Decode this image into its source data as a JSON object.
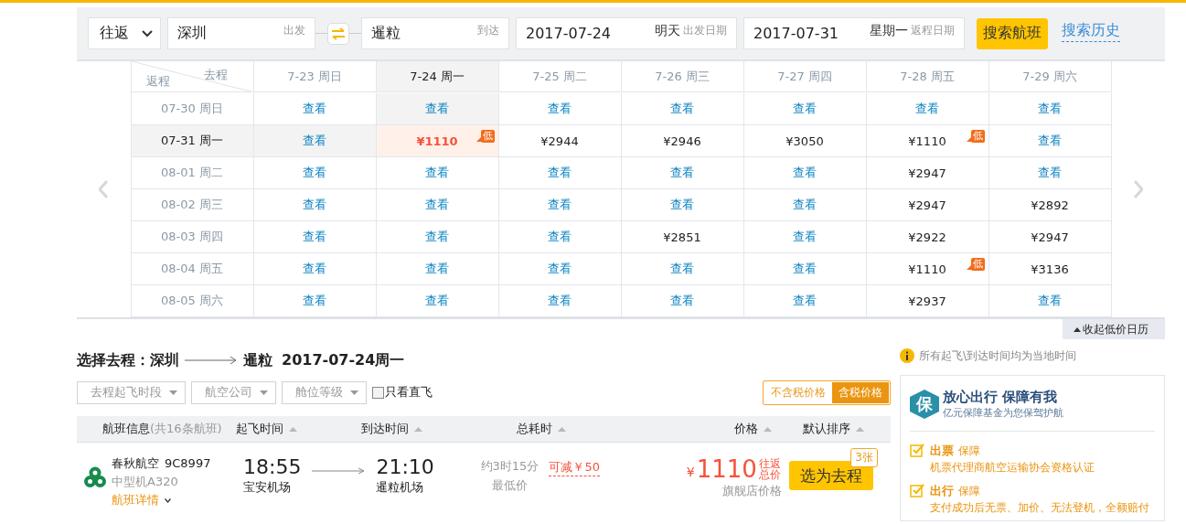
{
  "search": {
    "trip_type": "往返",
    "from": {
      "value": "深圳",
      "hint": "出发"
    },
    "to": {
      "value": "暹粒",
      "hint": "到达"
    },
    "depart": {
      "value": "2017-07-24",
      "day": "明天",
      "hint": "出发日期"
    },
    "return": {
      "value": "2017-07-31",
      "day": "星期一",
      "hint": "返程日期"
    },
    "search_button": "搜索航班",
    "history_link": "搜索历史"
  },
  "calendar": {
    "corner_top": "去程",
    "corner_bottom": "返程",
    "columns": [
      {
        "label": "7-23 周日",
        "selected": false
      },
      {
        "label": "7-24 周一",
        "selected": true
      },
      {
        "label": "7-25 周二",
        "selected": false
      },
      {
        "label": "7-26 周三",
        "selected": false
      },
      {
        "label": "7-27 周四",
        "selected": false
      },
      {
        "label": "7-28 周五",
        "selected": false
      },
      {
        "label": "7-29 周六",
        "selected": false
      }
    ],
    "rows": [
      {
        "label": "07-30 周日",
        "selected": false,
        "cells": [
          {
            "kind": "link",
            "text": "查看"
          },
          {
            "kind": "link",
            "text": "查看"
          },
          {
            "kind": "link",
            "text": "查看"
          },
          {
            "kind": "link",
            "text": "查看"
          },
          {
            "kind": "link",
            "text": "查看"
          },
          {
            "kind": "link",
            "text": "查看"
          },
          {
            "kind": "link",
            "text": "查看"
          }
        ]
      },
      {
        "label": "07-31 周一",
        "selected": true,
        "cells": [
          {
            "kind": "link",
            "text": "查看"
          },
          {
            "kind": "price",
            "text": "¥1110",
            "badge": "低"
          },
          {
            "kind": "price",
            "text": "¥2944"
          },
          {
            "kind": "price",
            "text": "¥2946"
          },
          {
            "kind": "price",
            "text": "¥3050"
          },
          {
            "kind": "price",
            "text": "¥1110",
            "badge": "低"
          },
          {
            "kind": "link",
            "text": "查看"
          }
        ]
      },
      {
        "label": "08-01 周二",
        "selected": false,
        "cells": [
          {
            "kind": "link",
            "text": "查看"
          },
          {
            "kind": "link",
            "text": "查看"
          },
          {
            "kind": "link",
            "text": "查看"
          },
          {
            "kind": "link",
            "text": "查看"
          },
          {
            "kind": "link",
            "text": "查看"
          },
          {
            "kind": "price",
            "text": "¥2947"
          },
          {
            "kind": "link",
            "text": "查看"
          }
        ]
      },
      {
        "label": "08-02 周三",
        "selected": false,
        "cells": [
          {
            "kind": "link",
            "text": "查看"
          },
          {
            "kind": "link",
            "text": "查看"
          },
          {
            "kind": "link",
            "text": "查看"
          },
          {
            "kind": "link",
            "text": "查看"
          },
          {
            "kind": "link",
            "text": "查看"
          },
          {
            "kind": "price",
            "text": "¥2947"
          },
          {
            "kind": "price",
            "text": "¥2892"
          }
        ]
      },
      {
        "label": "08-03 周四",
        "selected": false,
        "cells": [
          {
            "kind": "link",
            "text": "查看"
          },
          {
            "kind": "link",
            "text": "查看"
          },
          {
            "kind": "link",
            "text": "查看"
          },
          {
            "kind": "price",
            "text": "¥2851"
          },
          {
            "kind": "link",
            "text": "查看"
          },
          {
            "kind": "price",
            "text": "¥2922"
          },
          {
            "kind": "price",
            "text": "¥2947"
          }
        ]
      },
      {
        "label": "08-04 周五",
        "selected": false,
        "cells": [
          {
            "kind": "link",
            "text": "查看"
          },
          {
            "kind": "link",
            "text": "查看"
          },
          {
            "kind": "link",
            "text": "查看"
          },
          {
            "kind": "link",
            "text": "查看"
          },
          {
            "kind": "link",
            "text": "查看"
          },
          {
            "kind": "price",
            "text": "¥1110",
            "badge": "低"
          },
          {
            "kind": "price",
            "text": "¥3136"
          }
        ]
      },
      {
        "label": "08-05 周六",
        "selected": false,
        "cells": [
          {
            "kind": "link",
            "text": "查看"
          },
          {
            "kind": "link",
            "text": "查看"
          },
          {
            "kind": "link",
            "text": "查看"
          },
          {
            "kind": "link",
            "text": "查看"
          },
          {
            "kind": "link",
            "text": "查看"
          },
          {
            "kind": "price",
            "text": "¥2937"
          },
          {
            "kind": "link",
            "text": "查看"
          }
        ]
      }
    ],
    "collapse_button": "收起低价日历"
  },
  "outbound": {
    "title_prefix": "选择去程：",
    "from": "深圳",
    "to": "暹粒",
    "date": "2017-07-24周一",
    "filters": [
      "去程起飞时段",
      "航空公司",
      "舱位等级"
    ],
    "direct_only": {
      "label": "只看直飞",
      "checked": false
    },
    "price_toggle": [
      {
        "label": "不含税价格",
        "selected": false
      },
      {
        "label": "含税价格",
        "selected": true
      }
    ],
    "columns": [
      {
        "label": "航班信息",
        "note": "(共16条航班)",
        "sortable": false
      },
      {
        "label": "起飞时间",
        "sortable": true
      },
      {
        "label": "到达时间",
        "sortable": true
      },
      {
        "label": "总耗时",
        "sortable": true
      },
      {
        "label": "价格",
        "sortable": true
      },
      {
        "label": "默认排序",
        "sortable": true
      }
    ],
    "flights": [
      {
        "airline": "春秋航空",
        "flight_no": "9C8997",
        "aircraft": "中型机A320",
        "details_link": "航班详情",
        "dep_time": "18:55",
        "dep_airport": "宝安机场",
        "arr_time": "21:10",
        "arr_airport": "暹粒机场",
        "duration": "约3时15分",
        "duration_note": "最低价",
        "discount": "可减￥50",
        "currency": "¥",
        "price": "1110",
        "price_note": "往返总价",
        "price_label": "旗舰店价格",
        "select_button": "选为去程",
        "ticket_badge": "3张"
      }
    ]
  },
  "notice": "所有起飞\\到达时间均为当地时间",
  "guarantee": {
    "badge": "保",
    "title": "放心出行 保障有我",
    "subtitle": "亿元保障基金为您保驾护航",
    "items": [
      {
        "title": "出票",
        "tag": "保障",
        "text": "机票代理商航空运输协会资格认证"
      },
      {
        "title": "出行",
        "tag": "保障",
        "text": "支付成功后无票、加价、无法登机，全额赔付"
      }
    ]
  }
}
